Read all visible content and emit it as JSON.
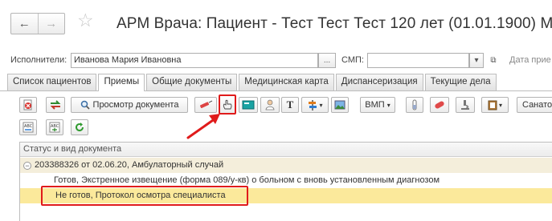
{
  "window": {
    "title": "АРМ Врача: Пациент - Тест Тест Тест 120 лет  (01.01.1900) М"
  },
  "header": {
    "executor_label": "Исполнители:",
    "executor_value": "Иванова Мария Ивановна",
    "smp_label": "СМП:",
    "smp_value": "",
    "date_label": "Дата прие",
    "dots": "...",
    "dropdown_glyph": "▾",
    "open_glyph": "⧉"
  },
  "nav": {
    "back": "←",
    "forward": "→",
    "favorite": "☆"
  },
  "tabs": [
    "Список пациентов",
    "Приемы",
    "Общие документы",
    "Медицинская карта",
    "Диспансеризация",
    "Текущие дела"
  ],
  "active_tab": "Приемы",
  "toolbar": {
    "view_document": "Просмотр документа",
    "text_T": "T",
    "vmp": "ВМП",
    "sanato": "Санато",
    "dropdown_glyph": "▾"
  },
  "table": {
    "header": "Статус и вид документа",
    "group_toggle": "−",
    "group_row": "203388326 от 02.06.20, Амбулаторный случай",
    "rows": [
      "Готов, Экстренное извещение (форма 089/у-кв) о больном с вновь установленным диагнозом",
      "Не готов, Протокол осмотра специалиста"
    ]
  },
  "colors": {
    "highlight_red": "#e01b1b",
    "selected_row": "#fbe99b",
    "group_row": "#f4eedb"
  }
}
